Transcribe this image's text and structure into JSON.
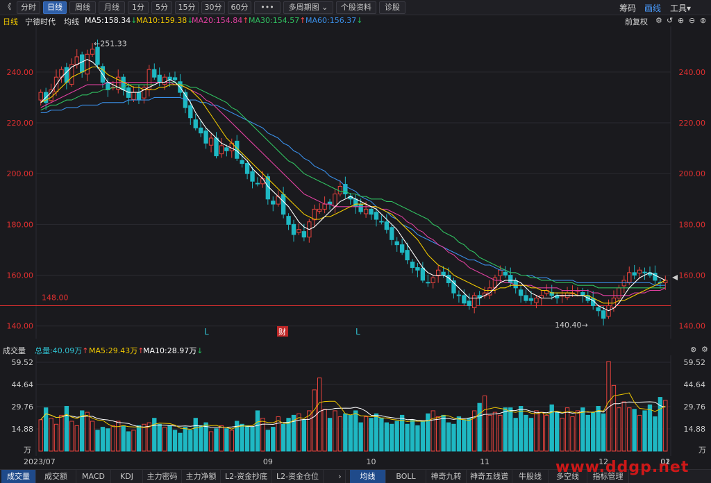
{
  "toolbar": {
    "back_glyph": "《",
    "buttons": [
      "分时",
      "日线",
      "周线",
      "月线",
      "1分",
      "5分",
      "15分",
      "30分",
      "60分",
      "•••",
      "多周期图",
      "个股资料",
      "诊股"
    ],
    "multi_period_chevron": "⌄",
    "active": "日线",
    "right": [
      "筹码",
      "画线",
      "工具"
    ],
    "right_active": "画线",
    "tools_chevron": "▾"
  },
  "ma_row": {
    "period": "日线",
    "stock": "宁德时代",
    "label": "均线",
    "ma5": "MA5:158.34",
    "ma10": "MA10:159.38",
    "ma20": "MA20:154.84",
    "ma30": "MA30:154.57",
    "ma60": "MA60:156.37",
    "adjust": "前复权",
    "colors": {
      "ma5": "#ffffff",
      "ma10": "#f0c800",
      "ma20": "#e040a0",
      "ma30": "#30c060",
      "ma60": "#3a8fe8"
    }
  },
  "main": {
    "y_labels": [
      "240.00",
      "220.00",
      "200.00",
      "180.00",
      "160.00",
      "140.00"
    ],
    "high_label": "251.33",
    "low_label": "140.40",
    "line_label": "148.00",
    "markers": [
      "L",
      "财",
      "L"
    ]
  },
  "vol_header": {
    "title": "成交量",
    "total": "总量:40.09万",
    "ma5": "MA5:29.43万",
    "ma10": "MA10:28.97万"
  },
  "vol": {
    "y_labels": [
      "59.52",
      "44.64",
      "29.76",
      "14.88",
      "万"
    ]
  },
  "x_labels": [
    "2023/07",
    "09",
    "10",
    "11",
    "12",
    "01",
    "02"
  ],
  "bottom_tabs_left": [
    "成交量",
    "成交额",
    "MACD",
    "KDJ",
    "主力密码",
    "主力净额",
    "L2-资金抄底",
    "L2-资金仓位"
  ],
  "bottom_tabs_right": [
    "均线",
    "BOLL",
    "神奇九转",
    "神奇五线谱",
    "牛股线",
    "多空线",
    "指标管理"
  ],
  "bottom_arrow": "›",
  "watermark": "www.ddgp.net",
  "chart_data": {
    "type": "candlestick",
    "ylim": [
      135,
      258
    ],
    "level_line": 148.0,
    "closes": [
      232,
      228,
      233,
      238,
      241,
      236,
      243,
      246,
      240,
      247,
      249,
      243,
      236,
      233,
      234,
      238,
      233,
      230,
      232,
      229,
      234,
      241,
      238,
      236,
      238,
      237,
      237,
      232,
      226,
      222,
      218,
      216,
      212,
      214,
      207,
      211,
      209,
      212,
      206,
      204,
      200,
      197,
      196,
      198,
      190,
      188,
      191,
      184,
      180,
      176,
      178,
      175,
      181,
      186,
      186,
      188,
      188,
      192,
      195,
      192,
      190,
      187,
      185,
      186,
      184,
      182,
      181,
      178,
      174,
      172,
      169,
      166,
      163,
      162,
      158,
      157,
      159,
      162,
      160,
      157,
      153,
      152,
      149,
      148,
      152,
      151,
      153,
      155,
      159,
      162,
      160,
      157,
      155,
      152,
      150,
      150,
      151,
      152,
      154,
      152,
      151,
      152,
      153,
      153,
      154,
      152,
      150,
      148,
      146,
      143,
      148,
      151,
      155,
      158,
      161,
      160,
      162,
      161,
      160,
      158,
      157,
      158
    ],
    "volumes": [
      21,
      29,
      22,
      18,
      24,
      30,
      20,
      17,
      27,
      26,
      20,
      14,
      16,
      15,
      17,
      20,
      17,
      13,
      14,
      17,
      18,
      19,
      22,
      18,
      16,
      17,
      14,
      12,
      16,
      14,
      22,
      17,
      19,
      13,
      15,
      17,
      15,
      14,
      20,
      18,
      17,
      16,
      27,
      22,
      14,
      16,
      23,
      18,
      22,
      24,
      25,
      21,
      27,
      41,
      49,
      28,
      22,
      27,
      23,
      25,
      24,
      27,
      19,
      23,
      22,
      25,
      22,
      19,
      18,
      20,
      24,
      18,
      21,
      17,
      20,
      25,
      27,
      23,
      24,
      19,
      18,
      23,
      21,
      22,
      27,
      32,
      37,
      24,
      26,
      24,
      29,
      29,
      22,
      30,
      24,
      22,
      27,
      26,
      24,
      31,
      26,
      22,
      29,
      23,
      27,
      29,
      24,
      26,
      30,
      25,
      60,
      44,
      29,
      33,
      29,
      28,
      24,
      27,
      31,
      23,
      36,
      34
    ],
    "ma5": [
      228,
      230,
      232,
      235,
      238,
      240,
      242,
      243,
      244,
      245,
      244,
      242,
      239,
      236,
      235,
      234,
      233,
      232,
      232,
      232,
      233,
      234,
      235,
      236,
      236,
      237,
      236,
      234,
      231,
      228,
      224,
      221,
      218,
      216,
      214,
      212,
      211,
      210,
      209,
      207,
      205,
      202,
      200,
      198,
      195,
      193,
      191,
      189,
      187,
      184,
      181,
      179,
      178,
      179,
      181,
      183,
      185,
      187,
      189,
      190,
      191,
      190,
      189,
      188,
      187,
      186,
      184,
      182,
      180,
      178,
      175,
      172,
      169,
      166,
      163,
      161,
      160,
      160,
      160,
      159,
      157,
      155,
      153,
      151,
      151,
      151,
      152,
      153,
      155,
      157,
      158,
      158,
      158,
      157,
      155,
      153,
      152,
      151,
      151,
      151,
      152,
      152,
      152,
      152,
      152,
      152,
      151,
      150,
      148,
      147,
      146,
      147,
      149,
      152,
      155,
      157,
      159,
      160,
      161,
      160,
      159,
      158
    ],
    "ma10": [
      228,
      229,
      230,
      232,
      234,
      236,
      238,
      239,
      240,
      241,
      242,
      242,
      241,
      239,
      238,
      237,
      236,
      235,
      234,
      234,
      233,
      233,
      233,
      234,
      234,
      235,
      235,
      235,
      234,
      233,
      231,
      229,
      226,
      223,
      220,
      217,
      214,
      212,
      210,
      208,
      206,
      204,
      202,
      200,
      198,
      196,
      194,
      192,
      190,
      188,
      186,
      184,
      183,
      182,
      182,
      183,
      183,
      184,
      185,
      186,
      187,
      188,
      188,
      188,
      187,
      187,
      186,
      185,
      184,
      182,
      180,
      178,
      176,
      174,
      171,
      168,
      166,
      164,
      163,
      162,
      160,
      159,
      158,
      157,
      156,
      155,
      154,
      154,
      154,
      155,
      155,
      156,
      156,
      156,
      156,
      155,
      155,
      154,
      154,
      153,
      153,
      153,
      153,
      153,
      152,
      152,
      152,
      151,
      150,
      149,
      149,
      149,
      150,
      150,
      151,
      152,
      153,
      154,
      155,
      156,
      157,
      158
    ],
    "ma20": [
      226,
      227,
      228,
      229,
      230,
      231,
      232,
      233,
      234,
      235,
      235,
      235,
      235,
      236,
      236,
      236,
      236,
      236,
      236,
      236,
      236,
      236,
      236,
      236,
      236,
      236,
      235,
      235,
      234,
      233,
      232,
      231,
      229,
      228,
      226,
      224,
      222,
      220,
      218,
      216,
      214,
      212,
      210,
      208,
      206,
      204,
      202,
      200,
      198,
      196,
      194,
      192,
      191,
      190,
      189,
      188,
      188,
      187,
      187,
      187,
      187,
      187,
      187,
      187,
      187,
      187,
      186,
      186,
      185,
      184,
      183,
      181,
      180,
      178,
      177,
      175,
      174,
      172,
      171,
      169,
      168,
      166,
      165,
      163,
      162,
      161,
      160,
      159,
      158,
      158,
      157,
      157,
      156,
      156,
      156,
      156,
      155,
      155,
      155,
      155,
      155,
      154,
      154,
      154,
      154,
      154,
      154,
      153,
      153,
      152,
      152,
      152,
      152,
      152,
      152,
      153,
      153,
      153,
      154,
      154,
      154,
      155
    ],
    "ma30": [
      225,
      226,
      227,
      227,
      228,
      229,
      229,
      230,
      231,
      231,
      232,
      232,
      233,
      233,
      234,
      234,
      234,
      235,
      235,
      235,
      235,
      235,
      235,
      236,
      236,
      236,
      236,
      235,
      235,
      234,
      234,
      233,
      232,
      231,
      230,
      229,
      228,
      226,
      225,
      223,
      221,
      219,
      217,
      215,
      213,
      211,
      209,
      207,
      205,
      204,
      202,
      200,
      199,
      198,
      197,
      196,
      195,
      194,
      193,
      193,
      192,
      192,
      191,
      191,
      190,
      190,
      190,
      189,
      189,
      188,
      187,
      186,
      185,
      184,
      183,
      182,
      180,
      179,
      177,
      176,
      175,
      173,
      172,
      170,
      169,
      167,
      166,
      165,
      164,
      163,
      162,
      161,
      161,
      160,
      160,
      159,
      159,
      158,
      158,
      158,
      157,
      157,
      157,
      157,
      156,
      156,
      156,
      156,
      155,
      155,
      155,
      155,
      155,
      155,
      155,
      155,
      155,
      155,
      155,
      155,
      155,
      155
    ],
    "ma60": [
      224,
      224,
      225,
      225,
      225,
      226,
      226,
      226,
      227,
      227,
      227,
      227,
      228,
      228,
      228,
      228,
      228,
      229,
      229,
      229,
      229,
      229,
      230,
      230,
      230,
      230,
      230,
      230,
      229,
      229,
      229,
      228,
      228,
      227,
      227,
      226,
      225,
      224,
      223,
      222,
      221,
      220,
      219,
      218,
      216,
      215,
      214,
      212,
      211,
      209,
      208,
      206,
      205,
      203,
      202,
      201,
      199,
      198,
      197,
      195,
      194,
      193,
      191,
      190,
      189,
      187,
      186,
      185,
      183,
      182,
      180,
      179,
      178,
      176,
      175,
      174,
      173,
      172,
      171,
      170,
      169,
      168,
      167,
      166,
      166,
      165,
      164,
      164,
      163,
      162,
      162,
      161,
      161,
      160,
      160,
      160,
      159,
      159,
      159,
      158,
      158,
      158,
      158,
      158,
      157,
      157,
      157,
      157,
      157,
      157,
      157,
      157,
      157,
      157,
      157,
      157,
      157,
      157,
      157,
      156,
      156,
      156
    ]
  }
}
